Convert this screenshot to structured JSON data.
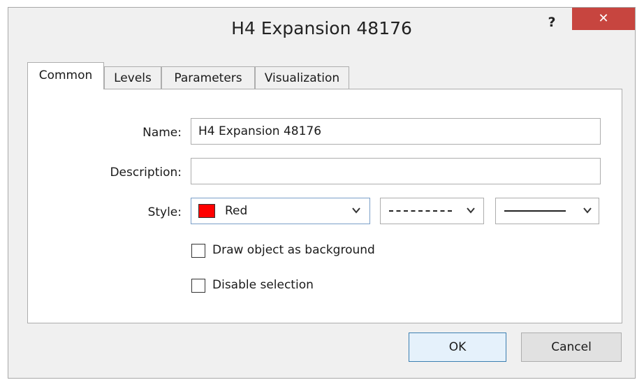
{
  "window": {
    "title": "H4 Expansion 48176",
    "help_label": "?",
    "close_label": "✕"
  },
  "tabs": [
    {
      "label": "Common",
      "active": true
    },
    {
      "label": "Levels",
      "active": false
    },
    {
      "label": "Parameters",
      "active": false
    },
    {
      "label": "Visualization",
      "active": false
    }
  ],
  "form": {
    "name_label": "Name:",
    "name_value": "H4 Expansion 48176",
    "description_label": "Description:",
    "description_value": "",
    "style_label": "Style:",
    "color_value": "Red",
    "color_hex": "#ff0000",
    "line_style_icon": "dashed-line-icon",
    "line_width_icon": "solid-line-icon",
    "draw_background_label": "Draw object as background",
    "draw_background_checked": false,
    "disable_selection_label": "Disable selection",
    "disable_selection_checked": false
  },
  "buttons": {
    "ok_label": "OK",
    "cancel_label": "Cancel"
  }
}
